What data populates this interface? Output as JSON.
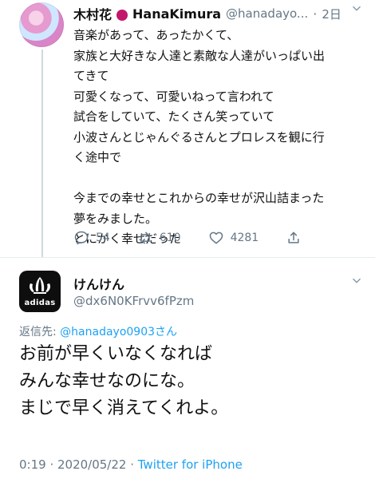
{
  "tweet1": {
    "author_name": "木村花",
    "author_name_suffix": "HanaKimura",
    "handle": "@hanadayo...",
    "dot": "·",
    "time": "2日",
    "lines": [
      "音楽があって、あったかくて、",
      "家族と大好きな人達と素敵な人達がいっぱい出",
      "てきて",
      "可愛くなって、可愛いねって言われて",
      "試合をしていて、たくさん笑っていて",
      "小波さんとじゃんぐるさんとプロレスを観に行",
      "く途中で",
      "",
      "今までの幸せとこれからの幸せが沢山詰まった",
      "夢をみました。",
      "とにかく幸せだった"
    ],
    "actions": {
      "reply_count": "54",
      "retweet_count": "610",
      "like_count": "4281"
    }
  },
  "tweet2": {
    "author_name": "けんけん",
    "handle": "@dx6N0KFrvv6fPzm",
    "avatar_label": "adidas",
    "replying_prefix": "返信先: ",
    "replying_mention": "@hanadayo0903さん",
    "lines": [
      "お前が早くいなくなれば",
      "みんな幸せなのにな。",
      "まじで早く消えてくれよ。"
    ],
    "meta_time": "0:19 · 2020/05/22 · ",
    "meta_source": "Twitter for iPhone"
  },
  "colors": {
    "accent": "#1DA1F2",
    "secondary_text": "#657786",
    "divider": "#e6ecf0"
  },
  "icons": [
    "comment-icon",
    "retweet-icon",
    "heart-icon",
    "share-icon",
    "chevron-down-icon",
    "rose-icon"
  ]
}
